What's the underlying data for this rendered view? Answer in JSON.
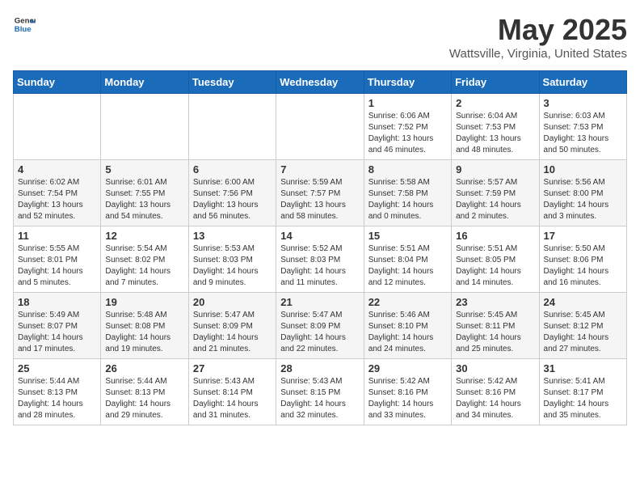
{
  "header": {
    "logo_general": "General",
    "logo_blue": "Blue",
    "month_title": "May 2025",
    "location": "Wattsville, Virginia, United States"
  },
  "days_of_week": [
    "Sunday",
    "Monday",
    "Tuesday",
    "Wednesday",
    "Thursday",
    "Friday",
    "Saturday"
  ],
  "weeks": [
    [
      {
        "day": "",
        "info": ""
      },
      {
        "day": "",
        "info": ""
      },
      {
        "day": "",
        "info": ""
      },
      {
        "day": "",
        "info": ""
      },
      {
        "day": "1",
        "info": "Sunrise: 6:06 AM\nSunset: 7:52 PM\nDaylight: 13 hours\nand 46 minutes."
      },
      {
        "day": "2",
        "info": "Sunrise: 6:04 AM\nSunset: 7:53 PM\nDaylight: 13 hours\nand 48 minutes."
      },
      {
        "day": "3",
        "info": "Sunrise: 6:03 AM\nSunset: 7:53 PM\nDaylight: 13 hours\nand 50 minutes."
      }
    ],
    [
      {
        "day": "4",
        "info": "Sunrise: 6:02 AM\nSunset: 7:54 PM\nDaylight: 13 hours\nand 52 minutes."
      },
      {
        "day": "5",
        "info": "Sunrise: 6:01 AM\nSunset: 7:55 PM\nDaylight: 13 hours\nand 54 minutes."
      },
      {
        "day": "6",
        "info": "Sunrise: 6:00 AM\nSunset: 7:56 PM\nDaylight: 13 hours\nand 56 minutes."
      },
      {
        "day": "7",
        "info": "Sunrise: 5:59 AM\nSunset: 7:57 PM\nDaylight: 13 hours\nand 58 minutes."
      },
      {
        "day": "8",
        "info": "Sunrise: 5:58 AM\nSunset: 7:58 PM\nDaylight: 14 hours\nand 0 minutes."
      },
      {
        "day": "9",
        "info": "Sunrise: 5:57 AM\nSunset: 7:59 PM\nDaylight: 14 hours\nand 2 minutes."
      },
      {
        "day": "10",
        "info": "Sunrise: 5:56 AM\nSunset: 8:00 PM\nDaylight: 14 hours\nand 3 minutes."
      }
    ],
    [
      {
        "day": "11",
        "info": "Sunrise: 5:55 AM\nSunset: 8:01 PM\nDaylight: 14 hours\nand 5 minutes."
      },
      {
        "day": "12",
        "info": "Sunrise: 5:54 AM\nSunset: 8:02 PM\nDaylight: 14 hours\nand 7 minutes."
      },
      {
        "day": "13",
        "info": "Sunrise: 5:53 AM\nSunset: 8:03 PM\nDaylight: 14 hours\nand 9 minutes."
      },
      {
        "day": "14",
        "info": "Sunrise: 5:52 AM\nSunset: 8:03 PM\nDaylight: 14 hours\nand 11 minutes."
      },
      {
        "day": "15",
        "info": "Sunrise: 5:51 AM\nSunset: 8:04 PM\nDaylight: 14 hours\nand 12 minutes."
      },
      {
        "day": "16",
        "info": "Sunrise: 5:51 AM\nSunset: 8:05 PM\nDaylight: 14 hours\nand 14 minutes."
      },
      {
        "day": "17",
        "info": "Sunrise: 5:50 AM\nSunset: 8:06 PM\nDaylight: 14 hours\nand 16 minutes."
      }
    ],
    [
      {
        "day": "18",
        "info": "Sunrise: 5:49 AM\nSunset: 8:07 PM\nDaylight: 14 hours\nand 17 minutes."
      },
      {
        "day": "19",
        "info": "Sunrise: 5:48 AM\nSunset: 8:08 PM\nDaylight: 14 hours\nand 19 minutes."
      },
      {
        "day": "20",
        "info": "Sunrise: 5:47 AM\nSunset: 8:09 PM\nDaylight: 14 hours\nand 21 minutes."
      },
      {
        "day": "21",
        "info": "Sunrise: 5:47 AM\nSunset: 8:09 PM\nDaylight: 14 hours\nand 22 minutes."
      },
      {
        "day": "22",
        "info": "Sunrise: 5:46 AM\nSunset: 8:10 PM\nDaylight: 14 hours\nand 24 minutes."
      },
      {
        "day": "23",
        "info": "Sunrise: 5:45 AM\nSunset: 8:11 PM\nDaylight: 14 hours\nand 25 minutes."
      },
      {
        "day": "24",
        "info": "Sunrise: 5:45 AM\nSunset: 8:12 PM\nDaylight: 14 hours\nand 27 minutes."
      }
    ],
    [
      {
        "day": "25",
        "info": "Sunrise: 5:44 AM\nSunset: 8:13 PM\nDaylight: 14 hours\nand 28 minutes."
      },
      {
        "day": "26",
        "info": "Sunrise: 5:44 AM\nSunset: 8:13 PM\nDaylight: 14 hours\nand 29 minutes."
      },
      {
        "day": "27",
        "info": "Sunrise: 5:43 AM\nSunset: 8:14 PM\nDaylight: 14 hours\nand 31 minutes."
      },
      {
        "day": "28",
        "info": "Sunrise: 5:43 AM\nSunset: 8:15 PM\nDaylight: 14 hours\nand 32 minutes."
      },
      {
        "day": "29",
        "info": "Sunrise: 5:42 AM\nSunset: 8:16 PM\nDaylight: 14 hours\nand 33 minutes."
      },
      {
        "day": "30",
        "info": "Sunrise: 5:42 AM\nSunset: 8:16 PM\nDaylight: 14 hours\nand 34 minutes."
      },
      {
        "day": "31",
        "info": "Sunrise: 5:41 AM\nSunset: 8:17 PM\nDaylight: 14 hours\nand 35 minutes."
      }
    ]
  ]
}
